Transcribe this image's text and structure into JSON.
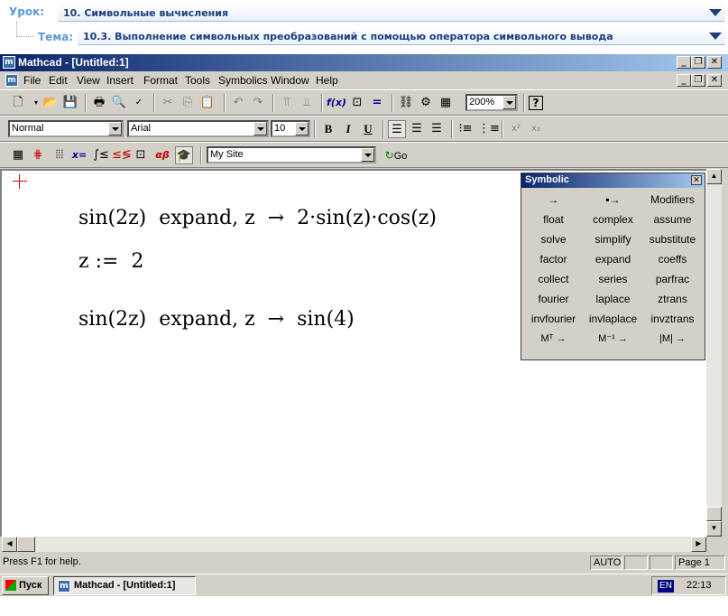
{
  "lesson": {
    "lesson_label": "Урок:",
    "lesson_value": "10. Символьные вычисления",
    "topic_label": "Тема:",
    "topic_value": "10.3. Выполнение символьных преобразований с помощью оператора символьного вывода"
  },
  "window": {
    "title": "Mathcad - [Untitled:1]",
    "app_icon": "m"
  },
  "menu": [
    "File",
    "Edit",
    "View",
    "Insert",
    "Format",
    "Tools",
    "Symbolics",
    "Window",
    "Help"
  ],
  "toolbar": {
    "zoom": "200%",
    "style": "Normal",
    "font": "Arial",
    "font_size": "10",
    "bold": "B",
    "italic": "I",
    "underline": "U",
    "resource": "My Site",
    "go_label": "Go"
  },
  "worksheet": {
    "line1": "sin(2z)  expand, z  →  2·sin(z)·cos(z)",
    "line2": "z :=  2",
    "line3": "sin(2z)  expand, z  →  sin(4)"
  },
  "palette": {
    "title": "Symbolic",
    "rows": [
      [
        "→",
        "▪→",
        "Modifiers"
      ],
      [
        "float",
        "complex",
        "assume"
      ],
      [
        "solve",
        "simplify",
        "substitute"
      ],
      [
        "factor",
        "expand",
        "coeffs"
      ],
      [
        "collect",
        "series",
        "parfrac"
      ],
      [
        "fourier",
        "laplace",
        "ztrans"
      ],
      [
        "invfourier",
        "invlaplace",
        "invztrans"
      ],
      [
        "Mᵀ →",
        "M⁻¹ →",
        "|M| →"
      ]
    ]
  },
  "status": {
    "help": "Press F1 for help.",
    "mode": "AUTO",
    "page": "Page 1"
  },
  "taskbar": {
    "start": "Пуск",
    "task": "Mathcad - [Untitled:1]",
    "lang": "EN",
    "clock": "22:13"
  }
}
